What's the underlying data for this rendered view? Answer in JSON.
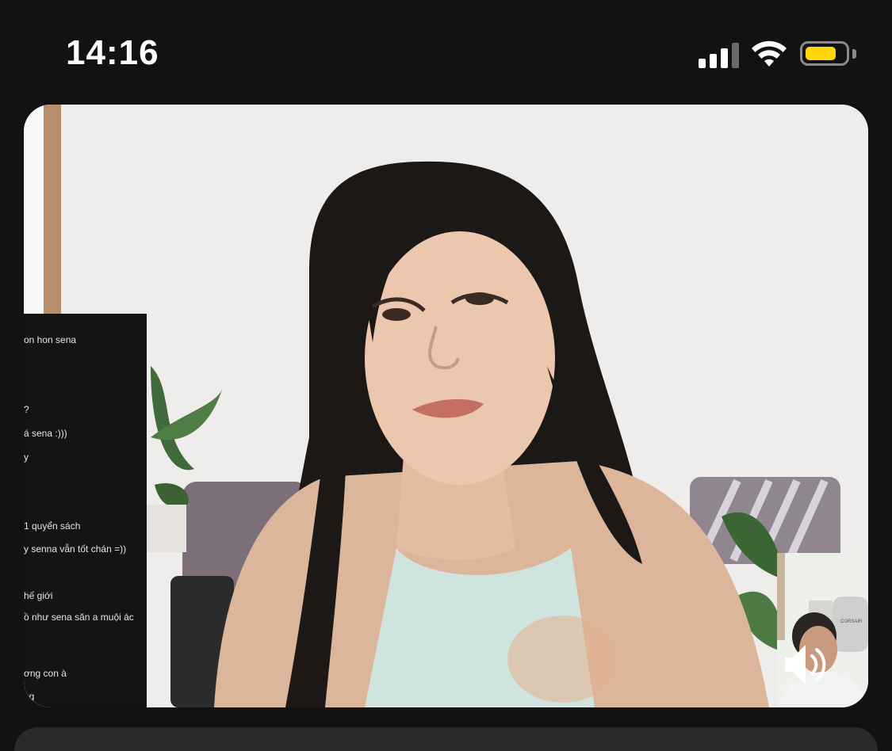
{
  "status_bar": {
    "time": "14:16",
    "signal_icon": "cellular-signal-icon",
    "wifi_icon": "wifi-icon",
    "battery_icon": "battery-icon",
    "battery_level": 0.8,
    "battery_color": "#ffd60a"
  },
  "video_call": {
    "remote_video": "video-feed",
    "chat_overlay": {
      "lines": [
        "",
        "on hon sena",
        "",
        "?",
        "á sena :)))",
        "y",
        "",
        "",
        "1 quyển sách",
        "y senna vẫn tốt chán =))",
        "",
        "hế giới",
        "ồ như sena săn a muội ác",
        "",
        "ơng con à",
        "ng"
      ]
    },
    "self_view": {
      "wall_label": "CORSAIR"
    },
    "speaker_icon": "speaker-icon"
  },
  "colors": {
    "background": "#121212",
    "sheet": "#2a2a2a"
  }
}
